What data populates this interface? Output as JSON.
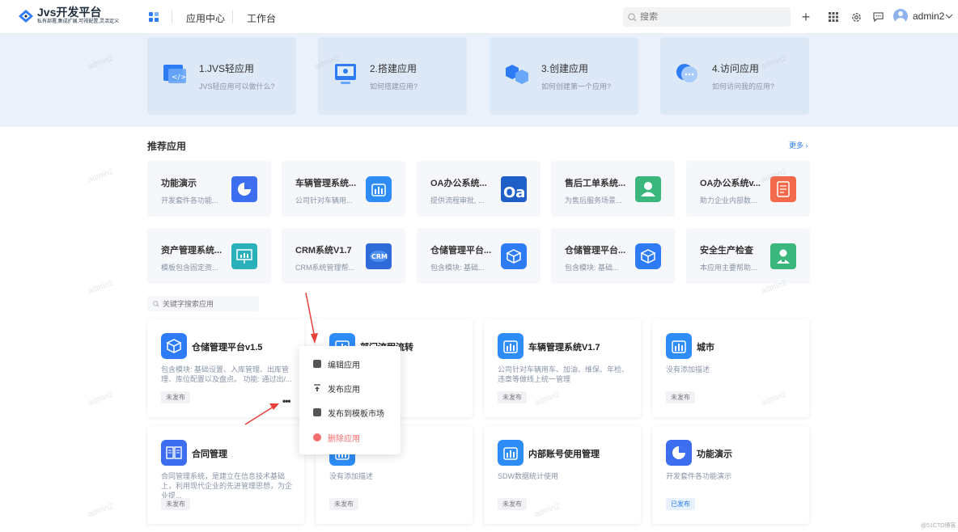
{
  "header": {
    "logo_title": "Jvs开发平台",
    "logo_sub": "私有部署,集成扩展,可视配置,灵活定义",
    "nav": [
      "应用中心",
      "工作台"
    ],
    "search_placeholder": "搜索",
    "user_name": "admin2"
  },
  "guide": [
    {
      "title": "1.JVS轻应用",
      "desc": "JVS轻应用可以做什么?",
      "icon": "code-window-icon"
    },
    {
      "title": "2.搭建应用",
      "desc": "如何搭建应用?",
      "icon": "monitor-icon"
    },
    {
      "title": "3.创建应用",
      "desc": "如何创建第一个应用?",
      "icon": "cubes-icon"
    },
    {
      "title": "4.访问应用",
      "desc": "如何访问我的应用?",
      "icon": "chat-bubble-icon"
    }
  ],
  "recommended": {
    "title": "推荐应用",
    "more": "更多",
    "items": [
      {
        "name": "功能演示",
        "desc": "开发套件各功能...",
        "color": "#3d6ef0",
        "icon": "pie-chart-icon"
      },
      {
        "name": "车辆管理系统...",
        "desc": "公司针对车辆用...",
        "color": "#2d8cf6",
        "icon": "bar-chart-icon"
      },
      {
        "name": "OA办公系统...",
        "desc": "提供流程审批, ...",
        "color": "#1f5fc8",
        "icon": "oa-logo-icon"
      },
      {
        "name": "售后工单系统...",
        "desc": "为售后服务场景...",
        "color": "#3bb77e",
        "icon": "user-service-icon"
      },
      {
        "name": "OA办公系统v...",
        "desc": "助力企业内部数...",
        "color": "#f26a4b",
        "icon": "document-icon"
      },
      {
        "name": "资产管理系统...",
        "desc": "模板包含固定资...",
        "color": "#2ab0b8",
        "icon": "presentation-icon"
      },
      {
        "name": "CRM系统V1.7",
        "desc": "CRM系统管理帮...",
        "color": "#2f6bd8",
        "icon": "crm-icon"
      },
      {
        "name": "仓储管理平台...",
        "desc": "包含模块: 基础...",
        "color": "#2d7cf6",
        "icon": "box-icon"
      },
      {
        "name": "仓储管理平台...",
        "desc": "包含模块: 基础...",
        "color": "#2d7cf6",
        "icon": "box-icon"
      },
      {
        "name": "安全生产检查",
        "desc": "本应用主要帮助...",
        "color": "#3bb77e",
        "icon": "user-shield-icon"
      }
    ]
  },
  "keyword_search_placeholder": "关键字搜索应用",
  "apps": [
    {
      "name": "仓储管理平台v1.5",
      "desc": "包含模块: 基础设置、入库管理、出库管理、库位配置以及盘点。 功能: 通过出/...",
      "status": "未发布",
      "color": "#2d7cf6",
      "icon": "box-icon"
    },
    {
      "name": "部门流程流转",
      "desc": "",
      "status": "",
      "color": "#2d8cf6",
      "icon": "bar-chart-icon"
    },
    {
      "name": "车辆管理系统V1.7",
      "desc": "公司针对车辆用车、加油、维保、年检、违章等做线上统一管理",
      "status": "未发布",
      "color": "#2d8cf6",
      "icon": "bar-chart-icon"
    },
    {
      "name": "城市",
      "desc": "没有添加描述",
      "status": "未发布",
      "color": "#2d8cf6",
      "icon": "bar-chart-icon"
    },
    {
      "name": "合同管理",
      "desc": "合同管理系统，是建立在信息技术基础上，利用现代企业的先进管理思想，为企业提...",
      "status": "未发布",
      "color": "#3d6ef0",
      "icon": "book-icon"
    },
    {
      "name": "",
      "desc": "没有添加描述",
      "status": "未发布",
      "color": "#2d8cf6",
      "icon": "bar-chart-icon"
    },
    {
      "name": "内部账号使用管理",
      "desc": "SDW数据统计使用",
      "status": "未发布",
      "color": "#2d8cf6",
      "icon": "bar-chart-icon"
    },
    {
      "name": "功能演示",
      "desc": "开发套件各功能演示",
      "status": "已发布",
      "color": "#3d6ef0",
      "icon": "pie-chart-icon"
    }
  ],
  "context_menu": [
    {
      "label": "编辑应用",
      "icon": "edit-icon"
    },
    {
      "label": "发布应用",
      "icon": "upload-icon"
    },
    {
      "label": "发布到模板市场",
      "icon": "template-icon"
    },
    {
      "label": "删除应用",
      "icon": "delete-icon"
    }
  ],
  "watermark": "admin2",
  "footer_mark": "@51CTO博客"
}
